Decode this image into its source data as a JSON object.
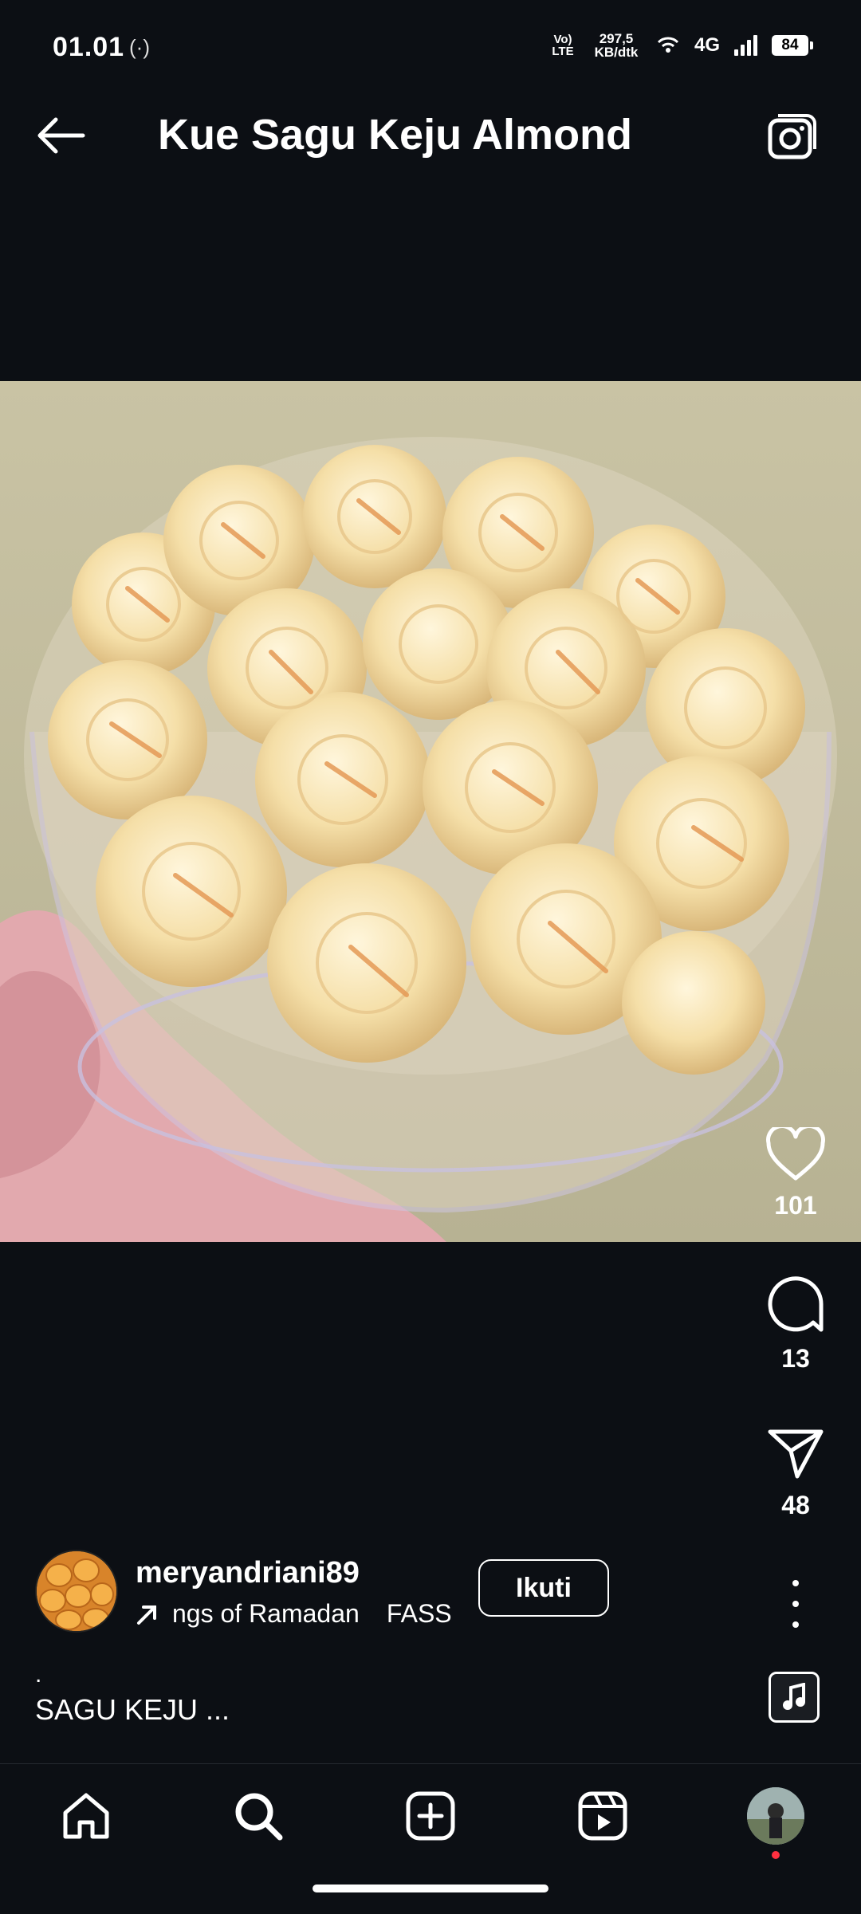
{
  "status_bar": {
    "time": "01.01",
    "volte": "Vo) LTE",
    "net_speed": "297,5 KB/dtk",
    "network": "4G",
    "battery": "84"
  },
  "header": {
    "title": "Kue Sagu Keju Almond"
  },
  "actions": {
    "likes": "101",
    "comments": "13",
    "shares": "48"
  },
  "author": {
    "username": "meryandriani89",
    "audio_text": "ngs of Ramadan",
    "audio_text_2": "FASS",
    "follow_label": "Ikuti"
  },
  "caption": {
    "line1": ".",
    "line2": "SAGU KEJU ..."
  },
  "colors": {
    "background": "#0c0f14",
    "notification_dot": "#ff3040"
  },
  "icons": [
    "back-arrow-icon",
    "camera-icon",
    "heart-icon",
    "comment-icon",
    "send-icon",
    "more-icon",
    "music-icon",
    "home-icon",
    "search-icon",
    "create-icon",
    "reels-icon"
  ]
}
